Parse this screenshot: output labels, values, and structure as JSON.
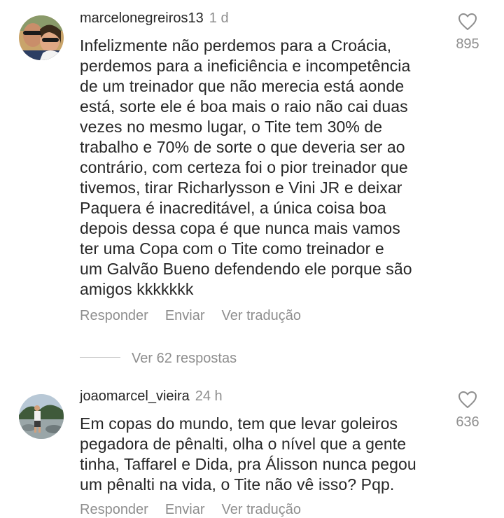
{
  "comments": [
    {
      "username": "marcelonegreiros13",
      "time": "1 d",
      "lines": [
        "Infelizmente não perdemos para a Croácia,",
        "perdemos para a ineficiência e incompetência",
        "de um treinador que não merecia está aonde",
        "está, sorte ele é boa mais o raio não cai duas",
        "vezes no mesmo lugar, o Tite tem 30% de",
        "trabalho e 70% de sorte o que deveria ser ao",
        "contrário, com certeza foi o pior treinador que",
        "tivemos, tirar Richarlysson e Vini JR e deixar",
        "Paquera é inacreditável, a única coisa boa",
        "depois dessa copa é que nunca mais vamos",
        "ter uma Copa com o Tite como treinador e",
        "um Galvão Bueno defendendo ele porque são",
        "amigos kkkkkkk"
      ],
      "likes": "895",
      "actions": {
        "reply": "Responder",
        "send": "Enviar",
        "translate": "Ver tradução"
      },
      "view_replies": "Ver 62 respostas"
    },
    {
      "username": "joaomarcel_vieira",
      "time": "24 h",
      "lines": [
        "Em copas do mundo, tem que levar goleiros",
        "pegadora de pênalti, olha o nível que a gente",
        "tinha, Taffarel e Dida, pra Álisson nunca pegou",
        "um pênalti na vida, o Tite não vê isso? Pqp."
      ],
      "likes": "636",
      "actions": {
        "reply": "Responder",
        "send": "Enviar",
        "translate": "Ver tradução"
      }
    }
  ],
  "icons": {
    "like": "heart-outline-icon"
  },
  "colors": {
    "primary_text": "#262626",
    "secondary_text": "#8e8e8e"
  }
}
